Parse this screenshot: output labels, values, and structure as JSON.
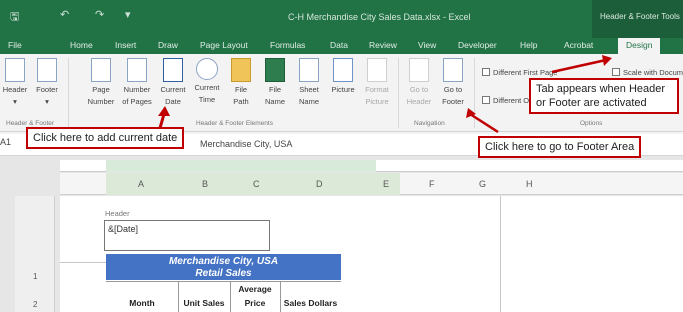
{
  "titlebar": {
    "doc_title": "C-H Merchandise City Sales Data.xlsx - Excel",
    "context_tab": "Header & Footer Tools"
  },
  "tabs": [
    "File",
    "Home",
    "Insert",
    "Draw",
    "Page Layout",
    "Formulas",
    "Data",
    "Review",
    "View",
    "Developer",
    "Help",
    "Acrobat",
    "Design"
  ],
  "ribbon": {
    "buttons": [
      {
        "label1": "Header",
        "label2": "▾"
      },
      {
        "label1": "Footer",
        "label2": "▾"
      },
      {
        "label1": "Page",
        "label2": "Number"
      },
      {
        "label1": "Number",
        "label2": "of Pages"
      },
      {
        "label1": "Current",
        "label2": "Date"
      },
      {
        "label1": "Current",
        "label2": "Time"
      },
      {
        "label1": "File",
        "label2": "Path"
      },
      {
        "label1": "File",
        "label2": "Name"
      },
      {
        "label1": "Sheet",
        "label2": "Name"
      },
      {
        "label1": "Picture",
        "label2": ""
      },
      {
        "label1": "Format",
        "label2": "Picture"
      },
      {
        "label1": "Go to",
        "label2": "Header"
      },
      {
        "label1": "Go to",
        "label2": "Footer"
      }
    ],
    "groups": {
      "hf": "Header & Footer",
      "elements": "Header & Footer Elements",
      "navigation": "Navigation",
      "options": "Options"
    },
    "options": {
      "different_first": "Different First Page",
      "different_odd": "Different Odd & Even Pages",
      "scale": "Scale with Document"
    }
  },
  "callouts": {
    "current_date": "Click here to add current date",
    "tab_appears": "Tab appears when Header or Footer are activated",
    "tab_appears_line1": "Tab appears when Header",
    "tab_appears_line2": "or Footer are activated",
    "go_footer": "Click here to go to Footer Area"
  },
  "formula_bar": {
    "name_box": "A1",
    "content": "Merchandise City, USA"
  },
  "columns": [
    "A",
    "B",
    "C",
    "D",
    "E",
    "F",
    "G",
    "H"
  ],
  "rows": [
    "1",
    "2"
  ],
  "header_area": {
    "label": "Header",
    "value": "&[Date]"
  },
  "table": {
    "title_line1": "Merchandise City, USA",
    "title_line2": "Retail Sales",
    "headers": [
      "Month",
      "Unit Sales",
      "Average Price",
      "Sales Dollars"
    ],
    "avg_line1": "Average",
    "avg_line2": "Price"
  },
  "colors": {
    "excel_green": "#217346",
    "table_blue": "#4472c4",
    "callout_red": "#c00000"
  }
}
